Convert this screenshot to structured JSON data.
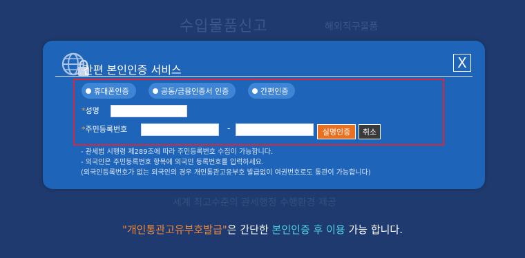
{
  "background": {
    "title": "수입물품신고",
    "title_suffix": "해외직구물품",
    "subtitle": "",
    "line2": "",
    "bottom_prefix": "",
    "bottom": "세계 최고수준의 관세행정 수행환경 제공"
  },
  "modal": {
    "icon": "globe-lock-icon",
    "title": "간편 본인인증 서비스",
    "close_label": "X",
    "methods": [
      {
        "label": "휴대폰인증"
      },
      {
        "label": "공동/금융인증서 인증"
      },
      {
        "label": "간편인증"
      }
    ],
    "required_mark": "*",
    "name_label": "성명",
    "rrn_label": "주민등록번호",
    "name_value": "",
    "rrn_front_value": "",
    "rrn_back_value": "",
    "rrn_separator": "-",
    "verify_button": "실명인증",
    "cancel_button": "취소",
    "notes": [
      "- 관세법 시행령 제289조에 따라 주민등록번호 수집이 가능합니다.",
      "- 외국인은 주민등록번호 항목에 외국인 등록번호를 입력하세요.",
      "(외국인등록번호가 없는 외국인의 경우 개인통관고유부호 발급없이 여권번호로도 통관이 가능합니다)"
    ]
  },
  "bottom_message": {
    "part1": "\"개인통관고유부호발급\"",
    "part2": "은 간단한 ",
    "part3": "본인인증 후 이용",
    "part4": " 가능 합니다."
  },
  "colors": {
    "page_bg": "#1f3a6e",
    "modal_bg": "#1e64b8",
    "highlight_border": "#d8263b",
    "verify_button": "#e8701e",
    "accent_orange": "#f08a3c",
    "accent_cyan": "#4fd2e6"
  }
}
